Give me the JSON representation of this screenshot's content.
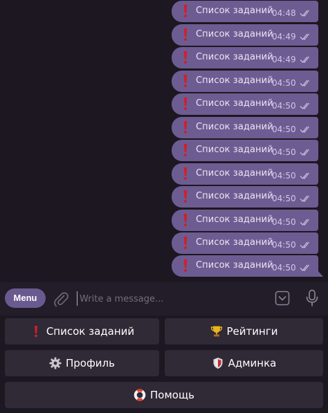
{
  "messages": [
    {
      "text": "Список заданий",
      "time": "04:48"
    },
    {
      "text": "Список заданий",
      "time": "04:49"
    },
    {
      "text": "Список заданий",
      "time": "04:49"
    },
    {
      "text": "Список заданий",
      "time": "04:50"
    },
    {
      "text": "Список заданий",
      "time": "04:50"
    },
    {
      "text": "Список заданий",
      "time": "04:50"
    },
    {
      "text": "Список заданий",
      "time": "04:50"
    },
    {
      "text": "Список заданий",
      "time": "04:50"
    },
    {
      "text": "Список заданий",
      "time": "04:50"
    },
    {
      "text": "Список заданий",
      "time": "04:50"
    },
    {
      "text": "Список заданий",
      "time": "04:50"
    },
    {
      "text": "Список заданий",
      "time": "04:50"
    }
  ],
  "composer": {
    "menu_label": "Menu",
    "placeholder": "Write a message..."
  },
  "keyboard": {
    "rows": [
      [
        {
          "label": "Список заданий",
          "icon": "exclamation-icon"
        },
        {
          "label": "Рейтинги",
          "icon": "trophy-icon"
        }
      ],
      [
        {
          "label": "Профиль",
          "icon": "gear-icon"
        },
        {
          "label": "Админка",
          "icon": "shield-icon"
        }
      ],
      [
        {
          "label": "Помощь",
          "icon": "lifebuoy-icon"
        }
      ]
    ]
  },
  "colors": {
    "background": "#1c1721",
    "bubble": "#6d5c91",
    "composer": "#221d28",
    "keyboard_button": "#302936",
    "menu_button": "#6a5a90",
    "exclamation": "#d0202a"
  }
}
